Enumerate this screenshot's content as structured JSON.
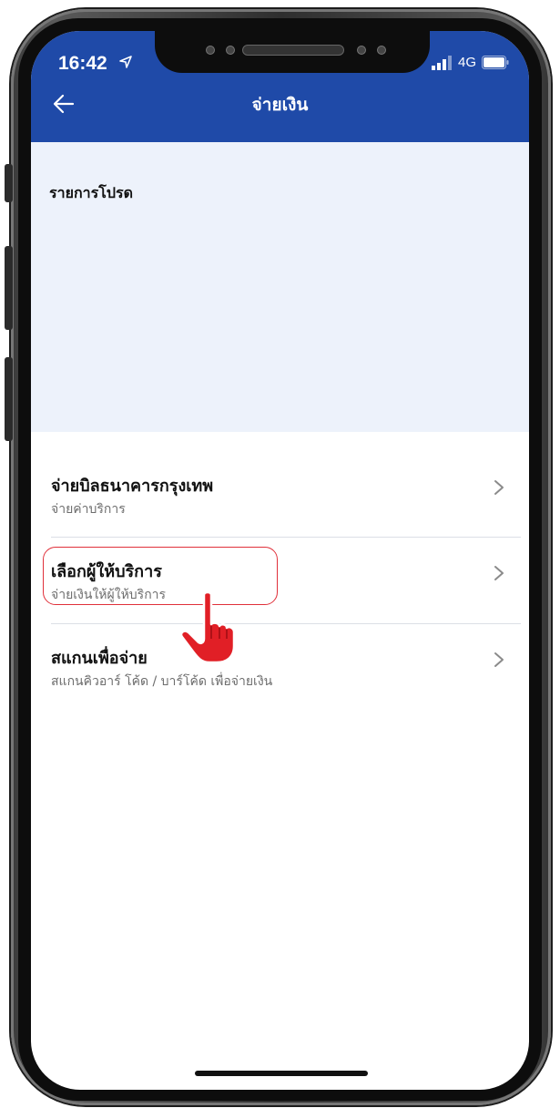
{
  "status_bar": {
    "time": "16:42",
    "network": "4G"
  },
  "header": {
    "title": "จ่ายเงิน"
  },
  "favorites": {
    "title": "รายการโปรด"
  },
  "menu": [
    {
      "title": "จ่ายบิลธนาคารกรุงเทพ",
      "subtitle": "จ่ายค่าบริการ"
    },
    {
      "title": "เลือกผู้ให้บริการ",
      "subtitle": "จ่ายเงินให้ผู้ให้บริการ"
    },
    {
      "title": "สแกนเพื่อจ่าย",
      "subtitle": "สแกนคิวอาร์ โค้ด / บาร์โค้ด เพื่อจ่ายเงิน"
    }
  ],
  "colors": {
    "header_blue": "#1f4aa8",
    "favorites_bg": "#edf2fb",
    "highlight_red": "#e0303a",
    "pointer_red": "#e11f26"
  },
  "icons": [
    "location-arrow-icon",
    "signal-icon",
    "battery-icon",
    "back-arrow-icon",
    "chevron-right-icon",
    "pointing-hand-icon"
  ]
}
